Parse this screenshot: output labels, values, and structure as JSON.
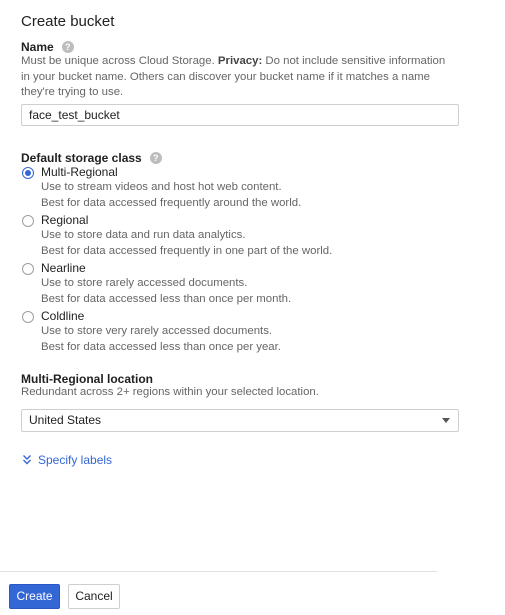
{
  "page": {
    "title": "Create bucket"
  },
  "name_section": {
    "label": "Name",
    "help_icon": "help-icon",
    "desc_pre": "Must be unique across Cloud Storage. ",
    "desc_bold": "Privacy:",
    "desc_post": " Do not include sensitive information in your bucket name. Others can discover your bucket name if it matches a name they're trying to use.",
    "value": "face_test_bucket"
  },
  "storage_class": {
    "label": "Default storage class",
    "help_icon": "help-icon",
    "options": [
      {
        "label": "Multi-Regional",
        "checked": true,
        "line1": "Use to stream videos and host hot web content.",
        "line2": "Best for data accessed frequently around the world."
      },
      {
        "label": "Regional",
        "checked": false,
        "line1": "Use to store data and run data analytics.",
        "line2": "Best for data accessed frequently in one part of the world."
      },
      {
        "label": "Nearline",
        "checked": false,
        "line1": "Use to store rarely accessed documents.",
        "line2": "Best for data accessed less than once per month."
      },
      {
        "label": "Coldline",
        "checked": false,
        "line1": "Use to store very rarely accessed documents.",
        "line2": "Best for data accessed less than once per year."
      }
    ]
  },
  "location": {
    "label": "Multi-Regional location",
    "desc": "Redundant across 2+ regions within your selected location.",
    "selected": "United States"
  },
  "labels_link": {
    "text": "Specify labels",
    "icon": "chevron-double-down-icon"
  },
  "actions": {
    "create": "Create",
    "cancel": "Cancel"
  },
  "colors": {
    "accent": "#3367d6",
    "text": "#212121",
    "muted": "#666666",
    "border": "#cfcfcf"
  }
}
